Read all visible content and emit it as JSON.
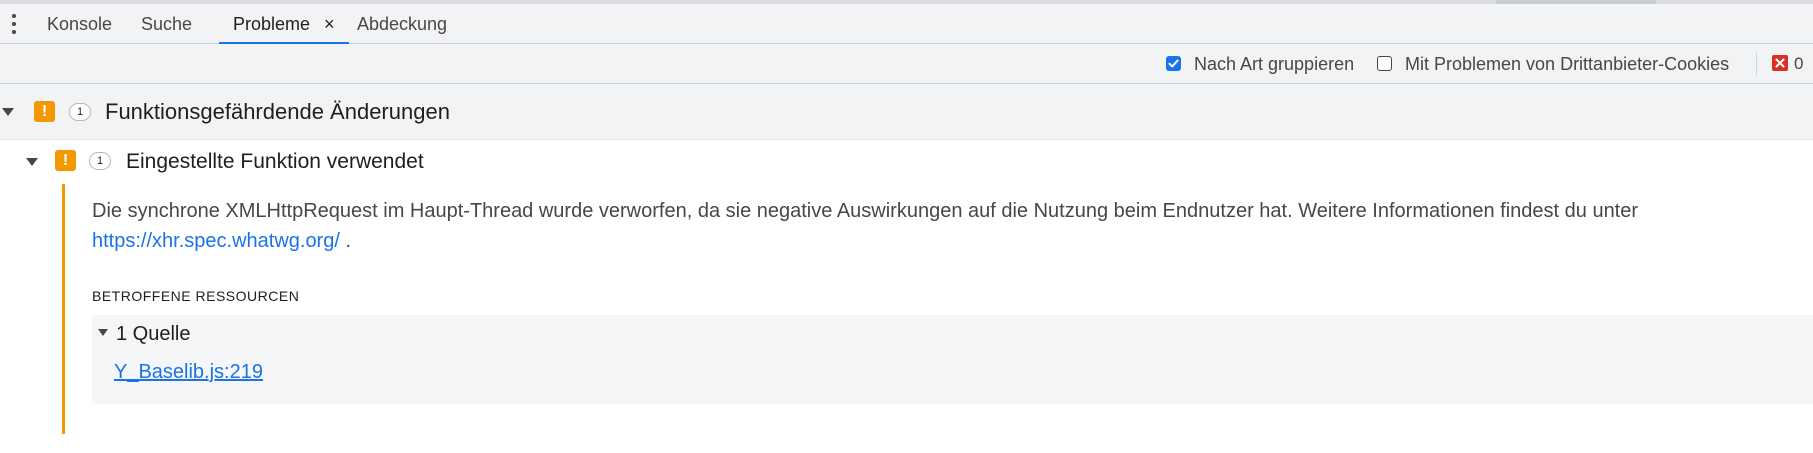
{
  "tabs": [
    {
      "label": "Konsole"
    },
    {
      "label": "Suche"
    },
    {
      "label": "Probleme",
      "active": true,
      "close_glyph": "×"
    },
    {
      "label": "Abdeckung"
    }
  ],
  "toolbar": {
    "group_by_kind": {
      "label": "Nach Art gruppieren",
      "checked": true
    },
    "third_party_cookies": {
      "label": "Mit Problemen von Drittanbieter-Cookies",
      "checked": false
    },
    "error_count": "0"
  },
  "category": {
    "title": "Funktionsgefährdende Änderungen",
    "count": "1",
    "icon": "warning-icon"
  },
  "issue": {
    "title": "Eingestellte Funktion verwendet",
    "count": "1",
    "description": "Die synchrone XMLHttpRequest im Haupt-Thread wurde verworfen, da sie negative Auswirkungen auf die Nutzung beim Endnutzer hat. Weitere Informationen findest du unter",
    "link": "https://xhr.spec.whatwg.org/",
    "period": ".",
    "affected_resources": {
      "heading": "BETROFFENE RESSOURCEN",
      "sources_label": "1 Quelle",
      "source_link": "Y_Baselib.js:219"
    }
  },
  "colors": {
    "accent": "#1a73e8",
    "warning": "#f29900",
    "error": "#d93025"
  }
}
